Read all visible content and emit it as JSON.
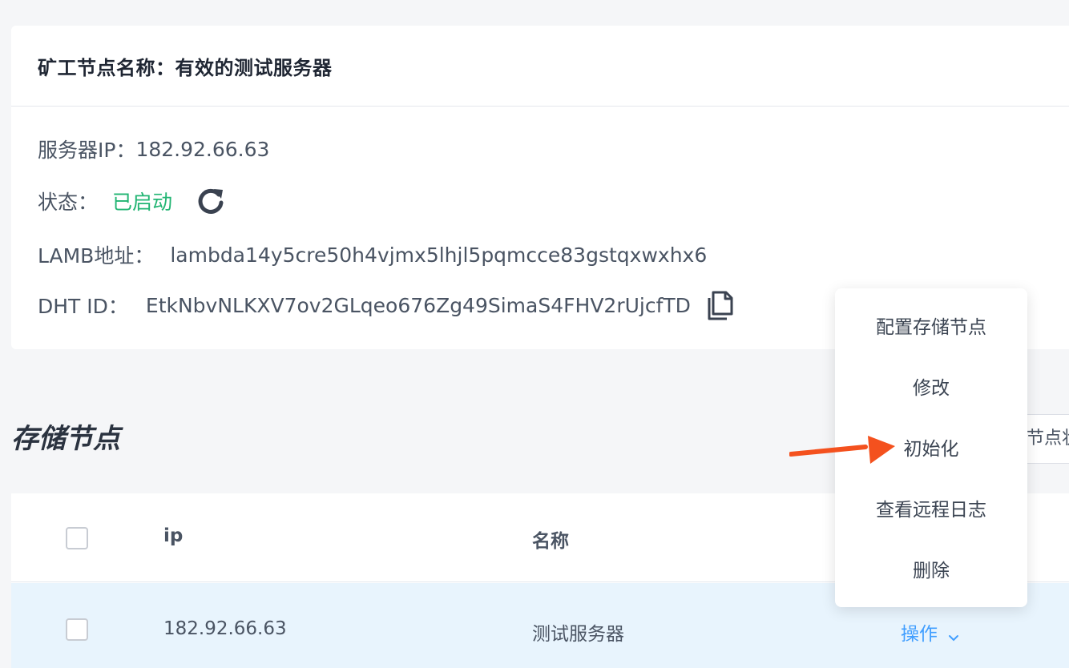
{
  "node": {
    "title": "矿工节点名称：有效的测试服务器",
    "ip_label": "服务器IP：",
    "ip_value": "182.92.66.63",
    "status_label": "状态：",
    "status_value": "已启动",
    "lamb_label": "LAMB地址：",
    "lamb_value": "lambda14y5cre50h4vjmx5lhjl5pqmcce83gstqxwxhx6",
    "dht_label": "DHT ID：",
    "dht_value": "EtkNbvNLKXV7ov2GLqeo676Zg49SimaS4FHV2rUjcfTD"
  },
  "storage": {
    "section_title": "存储节点",
    "filter_button": "节点状态"
  },
  "table": {
    "columns": [
      "ip",
      "名称"
    ],
    "rows": [
      {
        "ip": "182.92.66.63",
        "name": "测试服务器",
        "action": "操作"
      }
    ]
  },
  "dropdown": {
    "items": [
      "配置存储节点",
      "修改",
      "初始化",
      "查看远程日志",
      "删除"
    ]
  },
  "colors": {
    "status_green": "#22b573",
    "link_blue": "#409eff",
    "arrow_red": "#f4511e",
    "row_highlight": "#e8f4fd"
  }
}
